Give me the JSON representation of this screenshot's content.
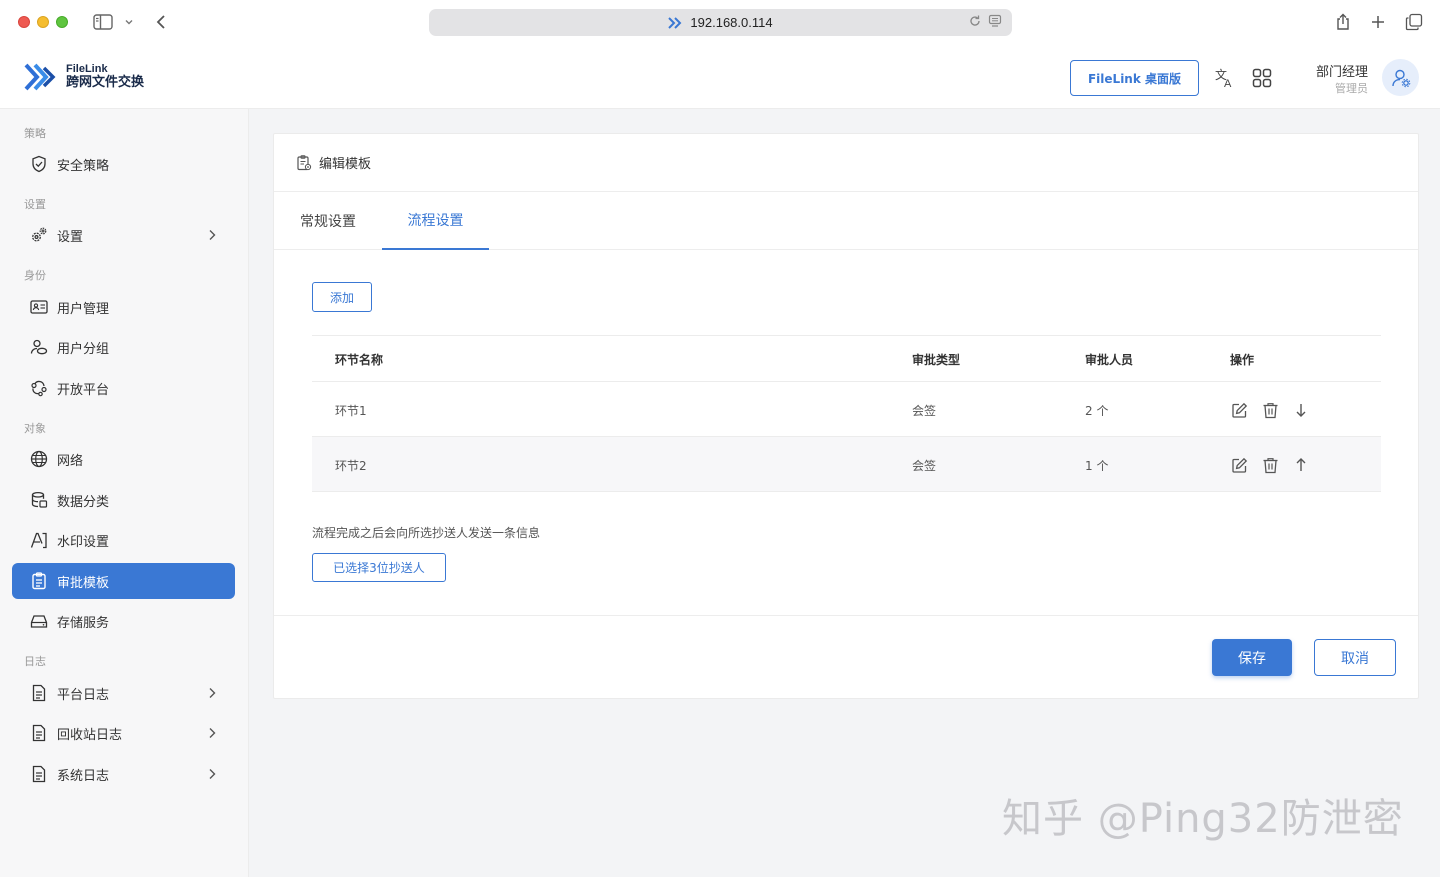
{
  "browser": {
    "url": "192.168.0.114"
  },
  "header": {
    "brand_en": "FileLink",
    "brand_cn": "跨网文件交换",
    "desktop_button": "FileLink 桌面版",
    "user_name": "部门经理",
    "user_role": "管理员"
  },
  "sidebar": {
    "sections": {
      "policy": "策略",
      "settings": "设置",
      "identity": "身份",
      "objects": "对象",
      "logs": "日志"
    },
    "items": {
      "security_policy": "安全策略",
      "settings": "设置",
      "user_management": "用户管理",
      "user_groups": "用户分组",
      "open_platform": "开放平台",
      "network": "网络",
      "data_classification": "数据分类",
      "watermark_settings": "水印设置",
      "approval_templates": "审批模板",
      "storage_service": "存储服务",
      "platform_log": "平台日志",
      "recycle_log": "回收站日志",
      "system_log": "系统日志"
    },
    "active": "approval_templates"
  },
  "card": {
    "title": "编辑模板",
    "tabs": [
      "常规设置",
      "流程设置"
    ],
    "active_tab": 1,
    "add_button": "添加",
    "table": {
      "headers": [
        "环节名称",
        "审批类型",
        "审批人员",
        "操作"
      ],
      "rows": [
        {
          "name": "环节1",
          "type": "会签",
          "count": "2 个",
          "move": "down"
        },
        {
          "name": "环节2",
          "type": "会签",
          "count": "1 个",
          "move": "up"
        }
      ]
    },
    "note": "流程完成之后会向所选抄送人发送一条信息",
    "cc_button": "已选择3位抄送人",
    "save_button": "保存",
    "cancel_button": "取消"
  },
  "watermark": "知乎 @Ping32防泄密",
  "colors": {
    "accent": "#3a78d4",
    "sidebar_bg": "#f7f7f8",
    "main_bg": "#f3f4f6"
  }
}
